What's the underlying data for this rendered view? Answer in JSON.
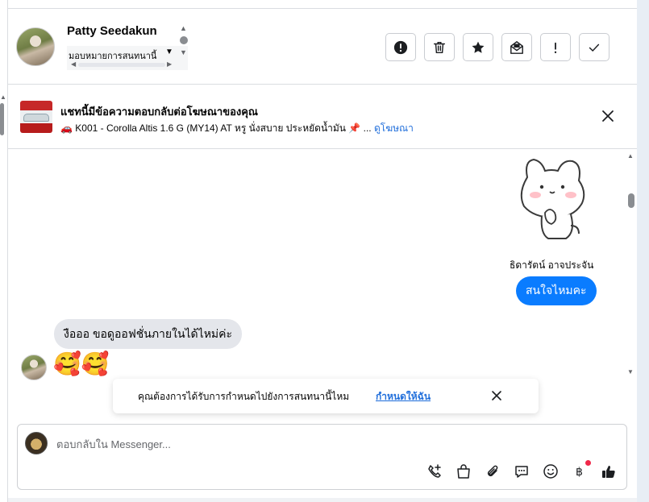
{
  "header": {
    "contact_name": "Patty Seedakun",
    "assign_label": "มอบหมายการสนทนานี้",
    "actions": [
      {
        "name": "report-button",
        "icon": "exclamation-circle-icon"
      },
      {
        "name": "delete-button",
        "icon": "trash-icon"
      },
      {
        "name": "star-button",
        "icon": "star-icon"
      },
      {
        "name": "mark-unread-button",
        "icon": "open-mail-icon"
      },
      {
        "name": "follow-up-button",
        "icon": "exclamation-icon"
      },
      {
        "name": "done-button",
        "icon": "checkmark-icon"
      }
    ]
  },
  "ad_banner": {
    "title": "แชทนี้มีข้อความตอบกลับต่อโฆษณาของคุณ",
    "description": "🚗 K001 - Corolla Altis 1.6 G (MY14) AT หรู นั่งสบาย ประหยัดน้ำมัน 📌 ...",
    "link_label": "ดูโฆษณา"
  },
  "messages": {
    "sender_name": "ธิดารัตน์ อาจประจัน",
    "outgoing_text": "สนใจไหมคะ",
    "incoming_text": "งือออ ขอดูออฟชั่นภายในได้ไหม่ค่ะ",
    "incoming_emojis": "🥰🥰"
  },
  "toast": {
    "text": "คุณต้องการได้รับการกำหนดไปยังการสนทนานี้ไหม",
    "link_label": "กำหนดให้ฉัน"
  },
  "composer": {
    "placeholder": "ตอบกลับใน Messenger...",
    "tools": [
      "call-add-icon",
      "shopping-bag-icon",
      "paperclip-icon",
      "chat-bubble-icon",
      "smiley-icon",
      "baht-icon",
      "thumbs-up-icon"
    ]
  },
  "colors": {
    "accent": "#0a7cff",
    "link": "#216fdb",
    "incoming_bubble": "#e4e6eb",
    "notification_dot": "#f02849"
  }
}
